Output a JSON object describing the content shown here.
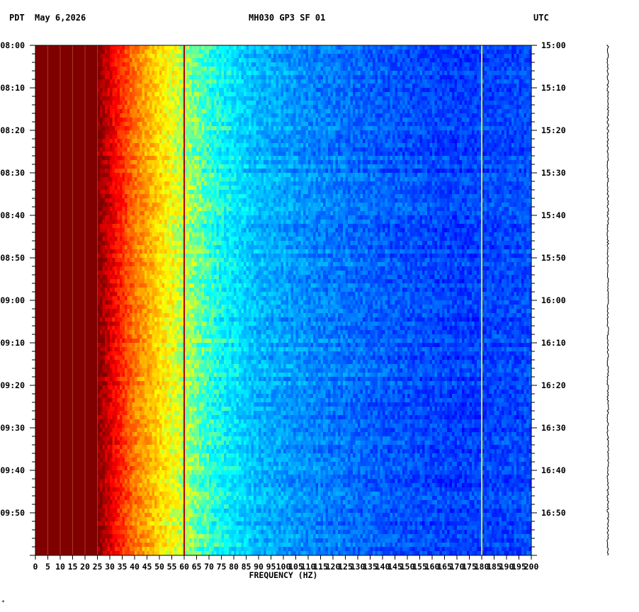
{
  "header": {
    "left_tz": "PDT",
    "date": "May 6,2026",
    "station": "MH030 GP3 SF 01",
    "right_tz": "UTC"
  },
  "chart_data": {
    "type": "heatmap",
    "title": "MH030 GP3 SF 01",
    "xlabel": "FREQUENCY (HZ)",
    "xlim": [
      0,
      200
    ],
    "x_ticks": [
      0,
      5,
      10,
      15,
      20,
      25,
      30,
      35,
      40,
      45,
      50,
      55,
      60,
      65,
      70,
      75,
      80,
      85,
      90,
      95,
      100,
      105,
      110,
      115,
      120,
      125,
      130,
      135,
      140,
      145,
      150,
      155,
      160,
      165,
      170,
      175,
      180,
      185,
      190,
      195,
      200
    ],
    "y_left_ticks": [
      "08:00",
      "08:10",
      "08:20",
      "08:30",
      "08:40",
      "08:50",
      "09:00",
      "09:10",
      "09:20",
      "09:30",
      "09:40",
      "09:50"
    ],
    "y_right_ticks": [
      "15:00",
      "15:10",
      "15:20",
      "15:30",
      "15:40",
      "15:50",
      "16:00",
      "16:10",
      "16:20",
      "16:30",
      "16:40",
      "16:50"
    ],
    "duration_minutes": 120,
    "colormap": [
      "#800000",
      "#ff0000",
      "#ff8000",
      "#ffff00",
      "#00ffff",
      "#0080ff",
      "#0000ff"
    ],
    "spectral_lines_hz": [
      60,
      180
    ],
    "background_profile": [
      {
        "hz": 0,
        "level": 1.0
      },
      {
        "hz": 25,
        "level": 1.0
      },
      {
        "hz": 32,
        "level": 0.84
      },
      {
        "hz": 40,
        "level": 0.68
      },
      {
        "hz": 50,
        "level": 0.55
      },
      {
        "hz": 60,
        "level": 0.45
      },
      {
        "hz": 75,
        "level": 0.33
      },
      {
        "hz": 90,
        "level": 0.24
      },
      {
        "hz": 110,
        "level": 0.18
      },
      {
        "hz": 140,
        "level": 0.12
      },
      {
        "hz": 170,
        "level": 0.08
      },
      {
        "hz": 200,
        "level": 0.1
      }
    ]
  }
}
